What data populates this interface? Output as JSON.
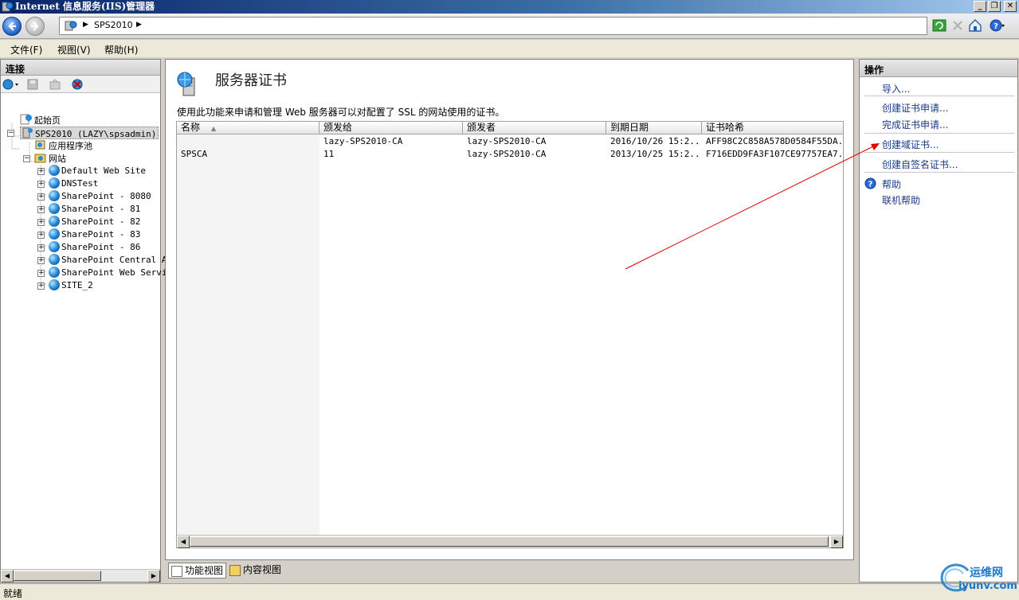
{
  "window": {
    "title": "Internet 信息服务(IIS)管理器"
  },
  "address": {
    "crumb": "SPS2010",
    "sep": "▶"
  },
  "menu": {
    "file": "文件(F)",
    "view": "视图(V)",
    "help": "帮助(H)"
  },
  "connections": {
    "title": "连接",
    "tree": {
      "start_page": "起始页",
      "server": "SPS2010 (LAZY\\spsadmin)",
      "app_pools": "应用程序池",
      "sites": "网站",
      "site_items": [
        "Default Web Site",
        "DNSTest",
        "SharePoint - 8080",
        "SharePoint - 81",
        "SharePoint - 82",
        "SharePoint - 83",
        "SharePoint - 86",
        "SharePoint Central A",
        "SharePoint Web Servi",
        "SITE_2"
      ]
    }
  },
  "main": {
    "title": "服务器证书",
    "description": "使用此功能来申请和管理 Web 服务器可以对配置了 SSL 的网站使用的证书。",
    "columns": [
      "名称",
      "颁发给",
      "颁发者",
      "到期日期",
      "证书哈希"
    ],
    "rows": [
      {
        "name": "",
        "issued_to": "lazy-SPS2010-CA",
        "issued_by": "lazy-SPS2010-CA",
        "expires": "2016/10/26 15:2...",
        "hash": "AFF98C2C858A578D0584F55DA..."
      },
      {
        "name": "SPSCA",
        "issued_to": "11",
        "issued_by": "lazy-SPS2010-CA",
        "expires": "2013/10/25 15:2...",
        "hash": "F716EDD9FA3F107CE97757EA7..."
      }
    ]
  },
  "view_tabs": {
    "feature": "功能视图",
    "content": "内容视图"
  },
  "actions": {
    "title": "操作",
    "import": "导入...",
    "create_request": "创建证书申请...",
    "complete_request": "完成证书申请...",
    "create_domain": "创建域证书...",
    "create_selfsigned": "创建自签名证书...",
    "help": "帮助",
    "online_help": "联机帮助"
  },
  "status": {
    "text": "就绪"
  },
  "watermark": {
    "line1": "运维网",
    "line2": "iyunv.com"
  },
  "colors": {
    "title_gradient_start": "#0a246a",
    "action_link": "#1a3a8a",
    "annotation_arrow": "#e00000"
  }
}
